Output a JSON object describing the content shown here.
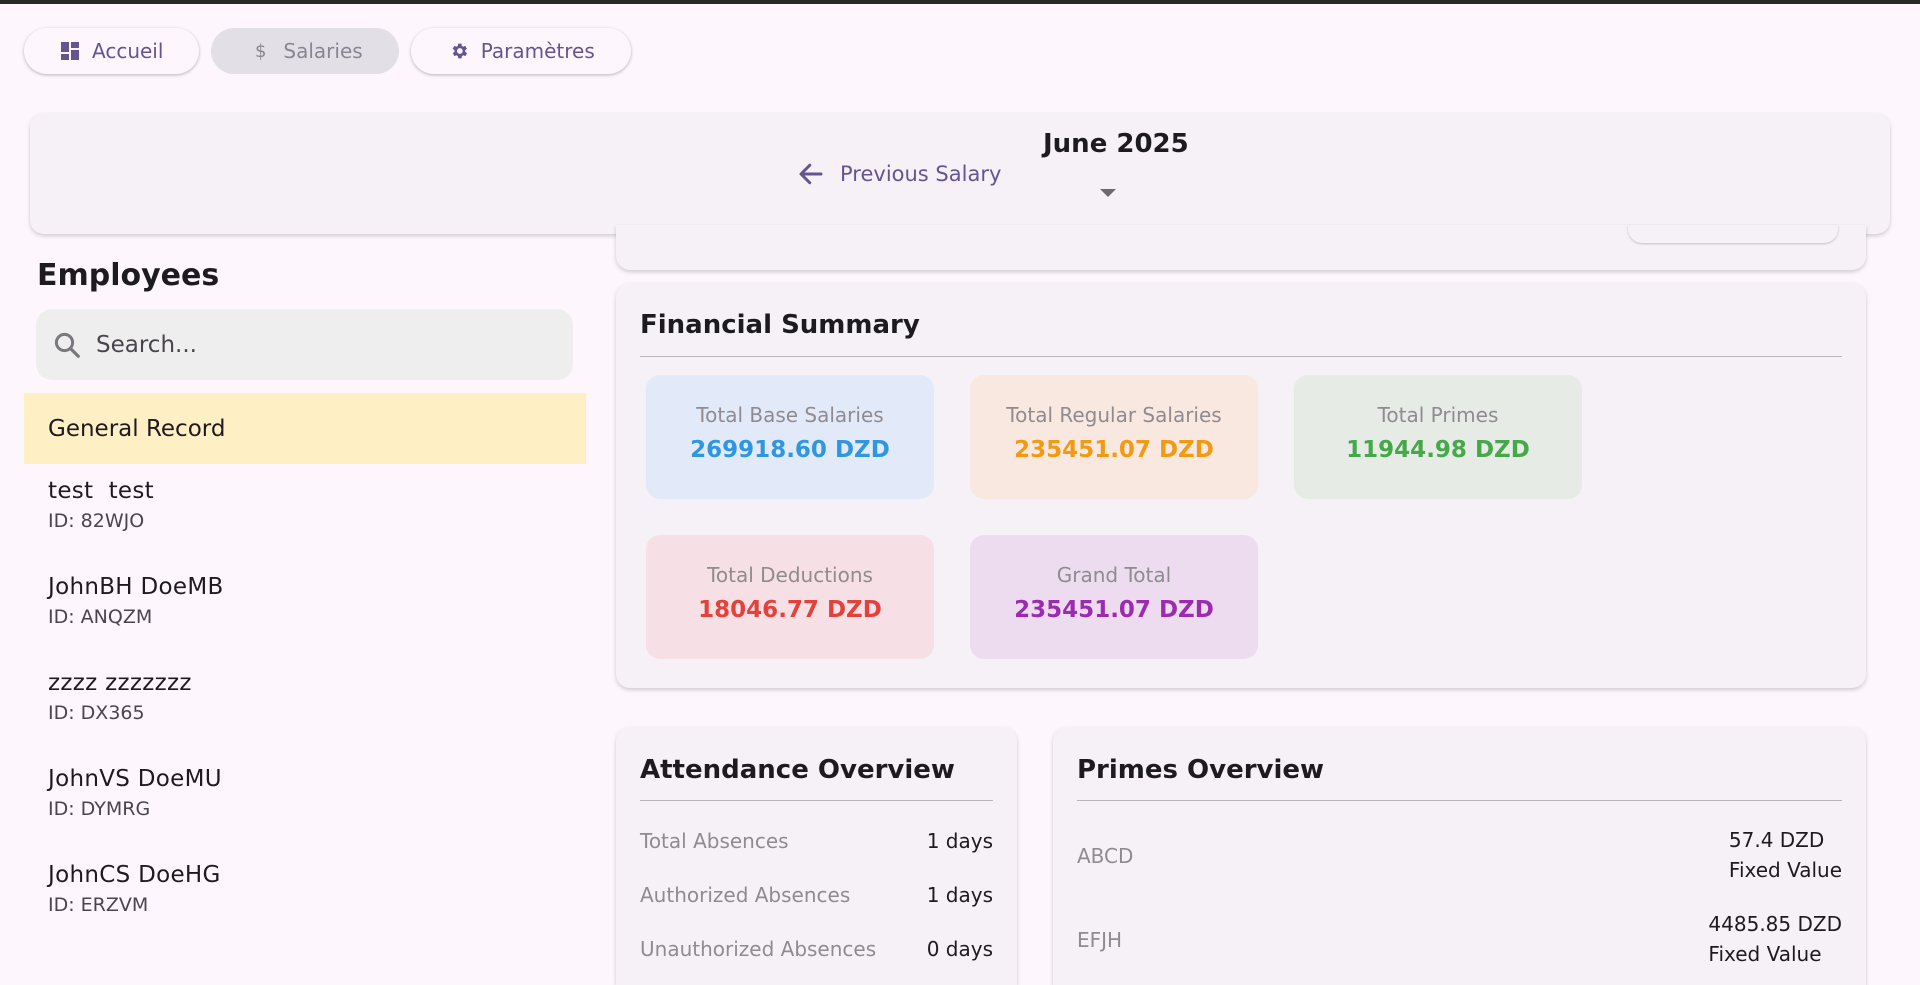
{
  "nav": {
    "items": [
      {
        "label": "Accueil",
        "icon": "dashboard-icon"
      },
      {
        "label": "Salaries",
        "icon": "dollar-icon"
      },
      {
        "label": "Paramètres",
        "icon": "gear-icon"
      }
    ]
  },
  "header": {
    "month": "June 2025",
    "prev_label": "Previous Salary"
  },
  "sidebar": {
    "title": "Employees",
    "search_placeholder": "Search...",
    "general_record": "General Record",
    "employees": [
      {
        "name": "test  test",
        "id": "ID: 82WJO"
      },
      {
        "name": "JohnBH DoeMB",
        "id": "ID: ANQZM"
      },
      {
        "name": "zzzz zzzzzzz",
        "id": "ID: DX365"
      },
      {
        "name": "JohnVS DoeMU",
        "id": "ID: DYMRG"
      },
      {
        "name": "JohnCS DoeHG",
        "id": "ID: ERZVM"
      }
    ]
  },
  "financial": {
    "title": "Financial Summary",
    "stats": [
      {
        "label": "Total Base Salaries",
        "value": "269918.60 DZD",
        "bg": "#e2e9f8",
        "color": "#2f96e0"
      },
      {
        "label": "Total Regular Salaries",
        "value": "235451.07 DZD",
        "bg": "#f8e8e0",
        "color": "#f29a12"
      },
      {
        "label": "Total Primes",
        "value": "11944.98 DZD",
        "bg": "#e6ebe6",
        "color": "#45a849"
      },
      {
        "label": "Total Deductions",
        "value": "18046.77 DZD",
        "bg": "#f6e0e6",
        "color": "#e5413b"
      },
      {
        "label": "Grand Total",
        "value": "235451.07 DZD",
        "bg": "#eddcf0",
        "color": "#9c2bb0"
      }
    ]
  },
  "attendance": {
    "title": "Attendance Overview",
    "rows": [
      {
        "label": "Total Absences",
        "value": "1 days"
      },
      {
        "label": "Authorized Absences",
        "value": "1 days"
      },
      {
        "label": "Unauthorized Absences",
        "value": "0 days"
      }
    ]
  },
  "primes": {
    "title": "Primes Overview",
    "items": [
      {
        "name": "ABCD",
        "amount": "57.4 DZD",
        "type": "Fixed Value"
      },
      {
        "name": "EFJH",
        "amount": "4485.85 DZD",
        "type": "Fixed Value"
      }
    ]
  }
}
